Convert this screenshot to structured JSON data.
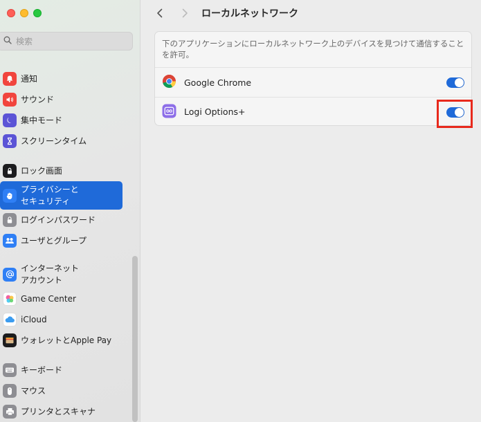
{
  "search": {
    "placeholder": "検索"
  },
  "sidebar": {
    "items": [
      {
        "label": "通知",
        "icon": "bell-icon",
        "color": "#f1453d"
      },
      {
        "label": "サウンド",
        "icon": "speaker-icon",
        "color": "#f1453d"
      },
      {
        "label": "集中モード",
        "icon": "moon-icon",
        "color": "#5b54d6"
      },
      {
        "label": "スクリーンタイム",
        "icon": "hourglass-icon",
        "color": "#5b54d6"
      },
      {
        "label": "ロック画面",
        "icon": "lock-screen-icon",
        "color": "#1c1c1e"
      },
      {
        "label": "プライバシーと\nセキュリティ",
        "icon": "hand-icon",
        "color": "#2f7ff5",
        "active": true
      },
      {
        "label": "ログインパスワード",
        "icon": "padlock-icon",
        "color": "#8e8e93"
      },
      {
        "label": "ユーザとグループ",
        "icon": "users-icon",
        "color": "#2f7ff5"
      },
      {
        "label": "インターネット\nアカウント",
        "icon": "at-icon",
        "color": "#2f7ff5"
      },
      {
        "label": "Game Center",
        "icon": "game-center-icon",
        "color": "#ffffff"
      },
      {
        "label": "iCloud",
        "icon": "icloud-icon",
        "color": "#ffffff"
      },
      {
        "label": "ウォレットとApple Pay",
        "icon": "wallet-icon",
        "color": "#1c1c1e"
      },
      {
        "label": "キーボード",
        "icon": "keyboard-icon",
        "color": "#8e8e93"
      },
      {
        "label": "マウス",
        "icon": "mouse-icon",
        "color": "#8e8e93"
      },
      {
        "label": "プリンタとスキャナ",
        "icon": "printer-icon",
        "color": "#8e8e93"
      }
    ]
  },
  "main": {
    "title": "ローカルネットワーク",
    "description": "下のアプリケーションにローカルネットワーク上のデバイスを見つけて通信することを許可。",
    "apps": [
      {
        "name": "Google Chrome",
        "icon": "chrome-icon",
        "enabled": true
      },
      {
        "name": "Logi Options+",
        "icon": "logi-options-icon",
        "enabled": true
      }
    ]
  },
  "colors": {
    "accent": "#1f6ad9",
    "highlight": "#e8291c"
  }
}
